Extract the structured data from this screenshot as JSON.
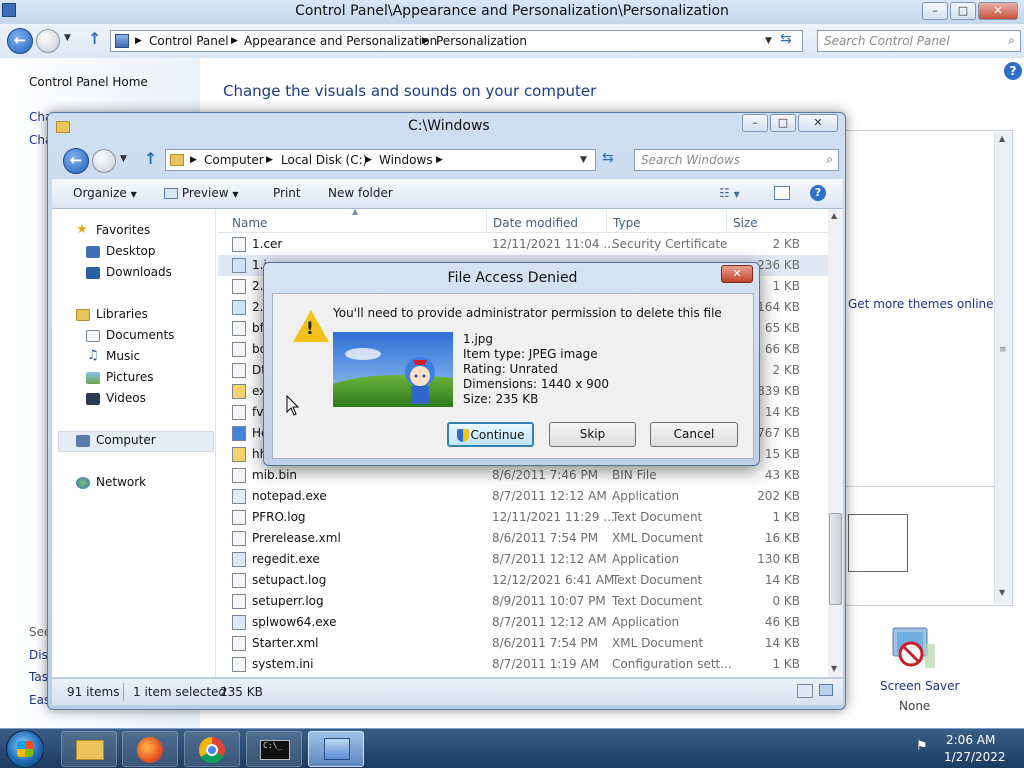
{
  "control_panel": {
    "title": "Control Panel\\Appearance and Personalization\\Personalization",
    "breadcrumbs": [
      "Control Panel",
      "Appearance and Personalization",
      "Personalization"
    ],
    "search_placeholder": "Search Control Panel",
    "home_link": "Control Panel Home",
    "left_links_partial": [
      "Cha",
      "Cha"
    ],
    "lower_links_partial": [
      "See",
      "Disp",
      "Tas",
      "Eas"
    ],
    "heading": "Change the visuals and sounds on your computer",
    "get_more_themes": "Get more themes online",
    "screen_saver_label": "Screen Saver",
    "screen_saver_value": "None"
  },
  "explorer": {
    "title": "C:\\Windows",
    "breadcrumbs": [
      "Computer",
      "Local Disk (C:)",
      "Windows"
    ],
    "search_placeholder": "Search Windows",
    "toolbar": {
      "organize": "Organize",
      "preview": "Preview",
      "print": "Print",
      "new_folder": "New folder"
    },
    "nav": {
      "favorites": "Favorites",
      "desktop": "Desktop",
      "downloads": "Downloads",
      "libraries": "Libraries",
      "documents": "Documents",
      "music": "Music",
      "pictures": "Pictures",
      "videos": "Videos",
      "computer": "Computer",
      "network": "Network"
    },
    "columns": [
      "Name",
      "Date modified",
      "Type",
      "Size"
    ],
    "files": [
      {
        "name": "1.cer",
        "date": "12/11/2021 11:04 ...",
        "type": "Security Certificate",
        "size": "2 KB"
      },
      {
        "name": "1.jpg",
        "date": "",
        "type": "",
        "size": "236 KB"
      },
      {
        "name": "2.",
        "date": "",
        "type": "",
        "size": "1 KB"
      },
      {
        "name": "2.j",
        "date": "",
        "type": "",
        "size": "164 KB"
      },
      {
        "name": "bf",
        "date": "",
        "type": "",
        "size": "65 KB"
      },
      {
        "name": "bo",
        "date": "",
        "type": "",
        "size": "66 KB"
      },
      {
        "name": "Dt",
        "date": "",
        "type": "",
        "size": "2 KB"
      },
      {
        "name": "ex",
        "date": "",
        "type": "",
        "size": ",839 KB"
      },
      {
        "name": "fv",
        "date": "",
        "type": "",
        "size": "14 KB"
      },
      {
        "name": "He",
        "date": "",
        "type": "",
        "size": "767 KB"
      },
      {
        "name": "hh",
        "date": "",
        "type": "",
        "size": "15 KB"
      },
      {
        "name": "mib.bin",
        "date": "8/6/2011 7:46 PM",
        "type": "BIN File",
        "size": "43 KB"
      },
      {
        "name": "notepad.exe",
        "date": "8/7/2011 12:12 AM",
        "type": "Application",
        "size": "202 KB"
      },
      {
        "name": "PFRO.log",
        "date": "12/11/2021 11:29 ...",
        "type": "Text Document",
        "size": "1 KB"
      },
      {
        "name": "Prerelease.xml",
        "date": "8/6/2011 7:54 PM",
        "type": "XML Document",
        "size": "16 KB"
      },
      {
        "name": "regedit.exe",
        "date": "8/7/2011 12:12 AM",
        "type": "Application",
        "size": "130 KB"
      },
      {
        "name": "setupact.log",
        "date": "12/12/2021 6:41 AM",
        "type": "Text Document",
        "size": "14 KB"
      },
      {
        "name": "setuperr.log",
        "date": "8/9/2011 10:07 PM",
        "type": "Text Document",
        "size": "0 KB"
      },
      {
        "name": "splwow64.exe",
        "date": "8/7/2011 12:12 AM",
        "type": "Application",
        "size": "46 KB"
      },
      {
        "name": "Starter.xml",
        "date": "8/6/2011 7:54 PM",
        "type": "XML Document",
        "size": "14 KB"
      },
      {
        "name": "system.ini",
        "date": "8/7/2011 1:19 AM",
        "type": "Configuration sett...",
        "size": "1 KB"
      }
    ],
    "status": {
      "count": "91 items",
      "selected": "1 item selected",
      "selected_size": "235 KB"
    }
  },
  "dialog": {
    "title": "File Access Denied",
    "message": "You'll need to provide administrator permission to delete this file",
    "file_name": "1.jpg",
    "item_type": "Item type: JPEG image",
    "rating": "Rating: Unrated",
    "dimensions": "Dimensions: 1440 x 900",
    "size": "Size: 235 KB",
    "buttons": {
      "continue": "Continue",
      "skip": "Skip",
      "cancel": "Cancel"
    }
  },
  "taskbar": {
    "time": "2:06 AM",
    "date": "1/27/2022"
  },
  "colors": {
    "link": "#1e3287",
    "heading": "#1e3b8a",
    "selection": "#dfe9f6",
    "taskbar": "#1d3c63"
  }
}
